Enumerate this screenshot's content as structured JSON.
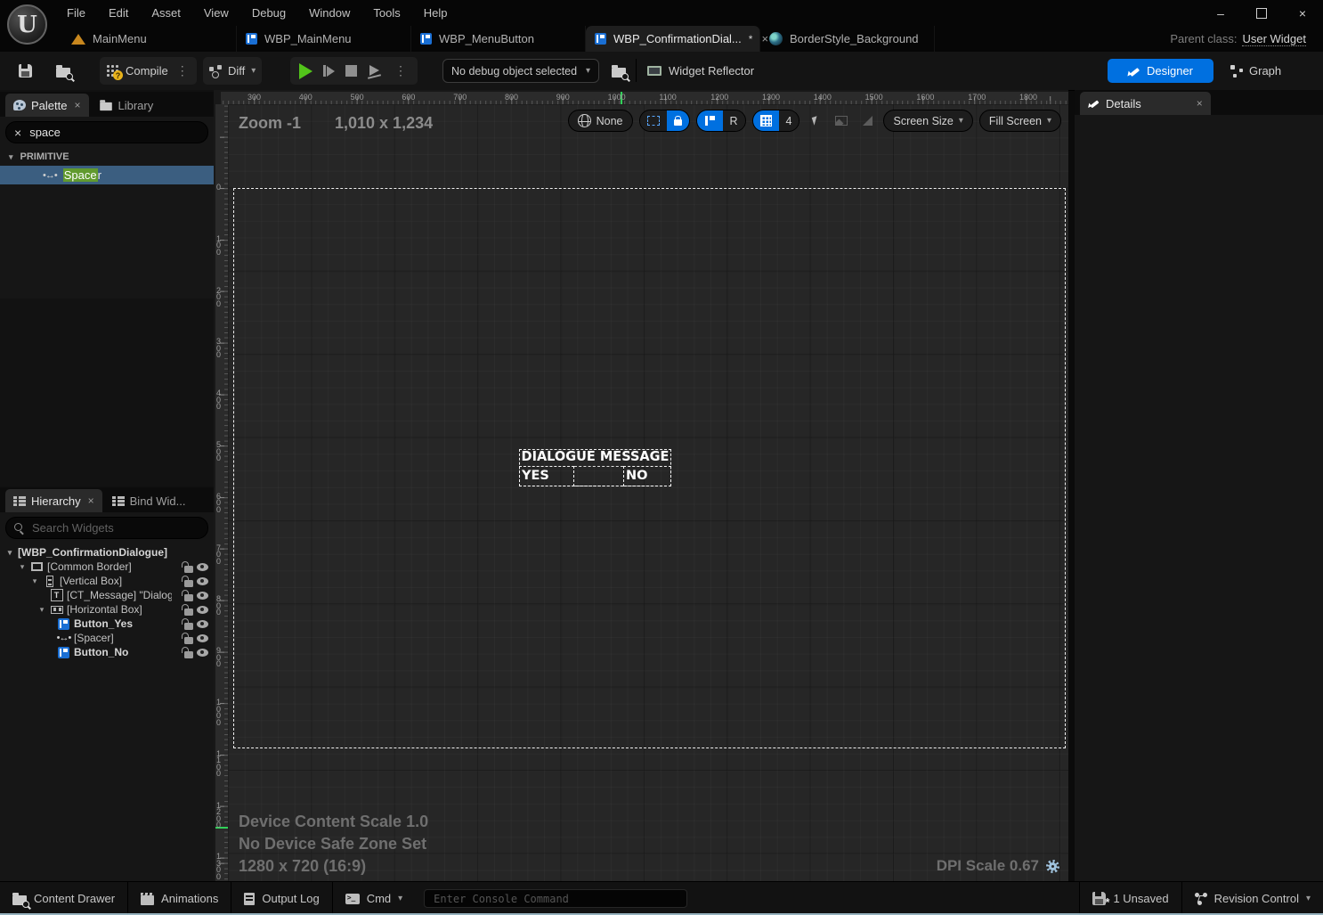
{
  "window": {
    "minimize": "–",
    "close": "×"
  },
  "menu_bar": {
    "items": [
      "File",
      "Edit",
      "Asset",
      "View",
      "Debug",
      "Window",
      "Tools",
      "Help"
    ]
  },
  "tab_bar": {
    "tabs": [
      {
        "label": "MainMenu",
        "icon": "level-icon"
      },
      {
        "label": "WBP_MainMenu",
        "icon": "widget-blueprint-icon"
      },
      {
        "label": "WBP_MenuButton",
        "icon": "widget-blueprint-icon"
      },
      {
        "label": "WBP_ConfirmationDial...",
        "icon": "widget-blueprint-icon",
        "dirty": "*",
        "close": "×",
        "active": true
      },
      {
        "label": "BorderStyle_Background",
        "icon": "material-icon"
      }
    ],
    "parent_class_label": "Parent class:",
    "parent_class_value": "User Widget"
  },
  "toolbar": {
    "compile_label": "Compile",
    "diff_label": "Diff",
    "debug_select_label": "No debug object selected",
    "widget_reflector_label": "Widget Reflector",
    "designer_label": "Designer",
    "graph_label": "Graph"
  },
  "palette": {
    "tab_palette": "Palette",
    "tab_library": "Library",
    "search_value": "space",
    "category": "PRIMITIVE",
    "item_match": "Space",
    "item_rest": "r"
  },
  "hierarchy": {
    "tab_hierarchy": "Hierarchy",
    "tab_bind": "Bind Wid...",
    "search_placeholder": "Search Widgets",
    "items": [
      {
        "label": "[WBP_ConfirmationDialogue]"
      },
      {
        "label": "[Common Border]"
      },
      {
        "label": "[Vertical Box]"
      },
      {
        "label": "[CT_Message] \"Dialogu"
      },
      {
        "label": "[Horizontal Box]"
      },
      {
        "label": "Button_Yes"
      },
      {
        "label": "[Spacer]"
      },
      {
        "label": "Button_No"
      }
    ]
  },
  "canvas": {
    "zoom_label": "Zoom -1",
    "size_label": "1,010 x 1,234",
    "localization_label": "None",
    "r_label": "R",
    "grid_snap_value": "4",
    "screen_size_label": "Screen Size",
    "fill_screen_label": "Fill Screen",
    "ruler_top": [
      "300",
      "400",
      "500",
      "600",
      "700",
      "800",
      "900",
      "1000",
      "1100",
      "1200",
      "1300",
      "1400",
      "1500",
      "1600",
      "1700",
      "1800"
    ],
    "ruler_left": [
      "0",
      "100",
      "200",
      "300",
      "400",
      "500",
      "600",
      "700",
      "800",
      "900",
      "1000",
      "1100",
      "1200",
      "1300"
    ],
    "widget": {
      "title": "Dialogue Message",
      "yes_label": "Yes",
      "no_label": "No"
    },
    "info_lines": [
      "Device Content Scale 1.0",
      "No Device Safe Zone Set",
      "1280 x 720 (16:9)"
    ],
    "dpi_label": "DPI Scale 0.67",
    "colors": {
      "widget_background": "#9a5cd8",
      "accent_blue": "#0070e0",
      "selection_row": "#3b5e80",
      "search_match_green": "#619a2e",
      "play_green": "#52c41a",
      "ruler_marker_green": "#30d158"
    }
  },
  "details": {
    "tab_label": "Details"
  },
  "status_bar": {
    "content_drawer_label": "Content Drawer",
    "animations_label": "Animations",
    "output_log_label": "Output Log",
    "cmd_label": "Cmd",
    "console_placeholder": "Enter Console Command",
    "unsaved_label": "1 Unsaved",
    "revision_label": "Revision Control"
  },
  "icons": {
    "close": "×",
    "chevron_down": "▾",
    "expander_open": "▾",
    "overflow_dots": "⋮",
    "spacer_glyph": "↔",
    "clear": "×"
  }
}
